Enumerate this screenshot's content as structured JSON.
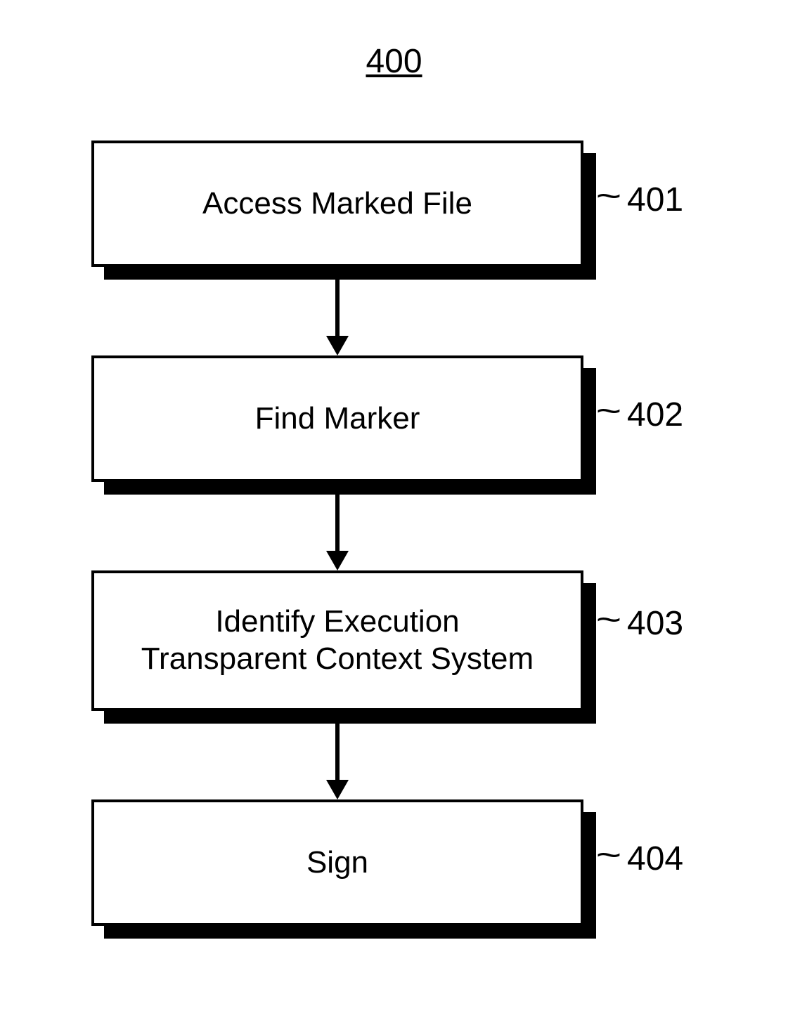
{
  "figure_number": "400",
  "nodes": {
    "n1": {
      "text": "Access Marked File",
      "ref": "401"
    },
    "n2": {
      "text": "Find Marker",
      "ref": "402"
    },
    "n3": {
      "text": "Identify Execution\nTransparent Context System",
      "ref": "403"
    },
    "n4": {
      "text": "Sign",
      "ref": "404"
    }
  }
}
